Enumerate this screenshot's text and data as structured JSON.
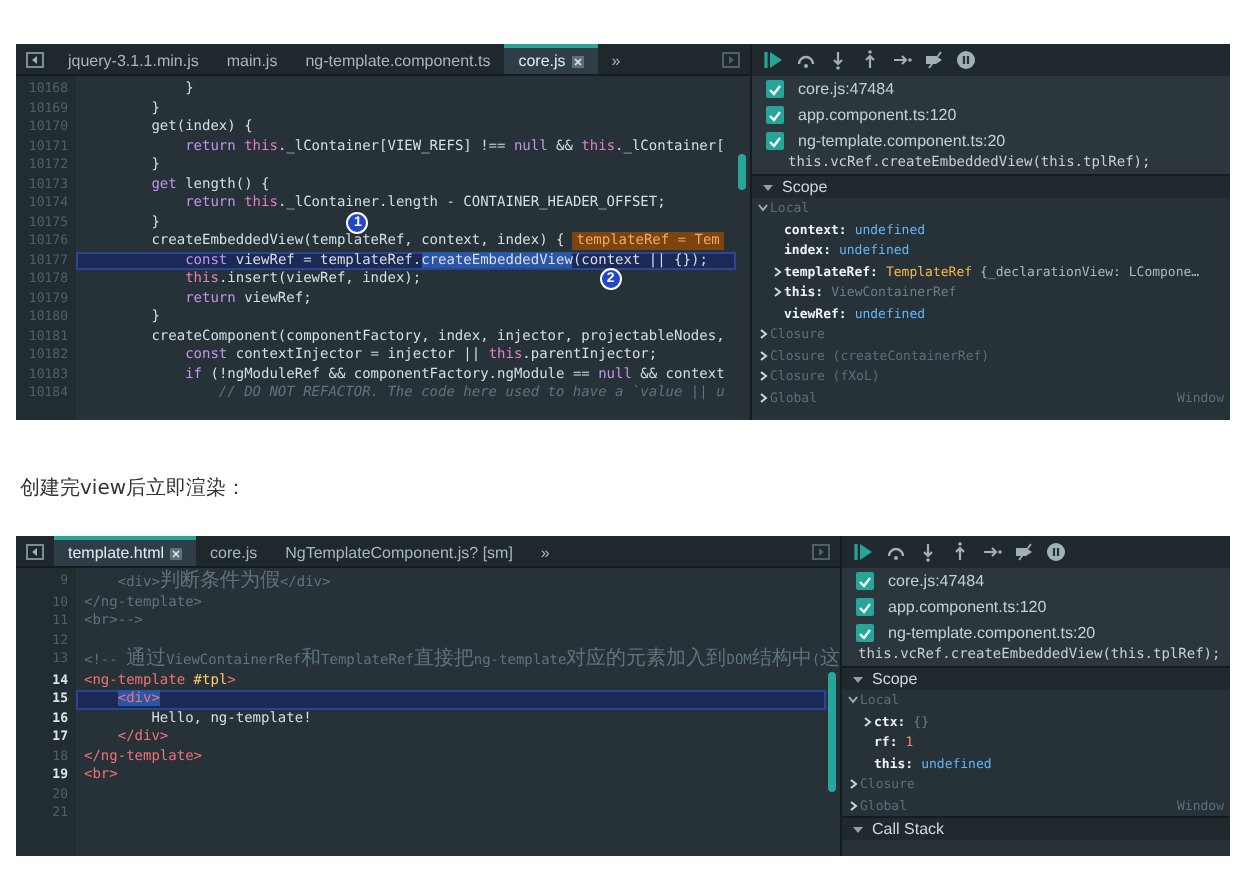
{
  "shots": [
    {
      "editor": {
        "tabs": [
          {
            "label": "jquery-3.1.1.min.js",
            "selected": false
          },
          {
            "label": "main.js",
            "selected": false
          },
          {
            "label": "ng-template.component.ts",
            "selected": false
          },
          {
            "label": "core.js",
            "selected": true
          }
        ],
        "overflow_label": "»",
        "lines": [
          {
            "number": "10168",
            "emphasized": false,
            "highlighted": false,
            "segments": [
              {
                "text": "            }",
                "kind": "plain"
              }
            ]
          },
          {
            "number": "10169",
            "emphasized": false,
            "highlighted": false,
            "segments": [
              {
                "text": "        }",
                "kind": "plain"
              }
            ]
          },
          {
            "number": "10170",
            "emphasized": false,
            "highlighted": false,
            "segments": [
              {
                "text": "        get(index) {",
                "kind": "plain"
              }
            ]
          },
          {
            "number": "10171",
            "emphasized": false,
            "highlighted": false,
            "segments": [
              {
                "text": "            return",
                "kind": "keyword"
              },
              {
                "text": " this",
                "kind": "this"
              },
              {
                "text": "._lContainer[VIEW_REFS] !== ",
                "kind": "plain"
              },
              {
                "text": "null",
                "kind": "keyword"
              },
              {
                "text": " && ",
                "kind": "plain"
              },
              {
                "text": "this",
                "kind": "this"
              },
              {
                "text": "._lContainer[",
                "kind": "plain"
              }
            ]
          },
          {
            "number": "10172",
            "emphasized": false,
            "highlighted": false,
            "segments": [
              {
                "text": "        }",
                "kind": "plain"
              }
            ]
          },
          {
            "number": "10173",
            "emphasized": false,
            "highlighted": false,
            "segments": [
              {
                "text": "        get",
                "kind": "keyword"
              },
              {
                "text": " length() {",
                "kind": "plain"
              }
            ]
          },
          {
            "number": "10174",
            "emphasized": false,
            "highlighted": false,
            "segments": [
              {
                "text": "            return",
                "kind": "keyword"
              },
              {
                "text": " this",
                "kind": "this"
              },
              {
                "text": "._lContainer.length - CONTAINER_HEADER_OFFSET;",
                "kind": "plain"
              }
            ]
          },
          {
            "number": "10175",
            "emphasized": false,
            "highlighted": false,
            "segments": [
              {
                "text": "        }",
                "kind": "plain"
              }
            ]
          },
          {
            "number": "10176",
            "emphasized": false,
            "highlighted": false,
            "hint": "templateRef = Tem",
            "segments": [
              {
                "text": "        createEmbeddedView(",
                "kind": "plain"
              },
              {
                "text": "templateRef",
                "kind": "plain",
                "marker": {
                  "label": "1",
                  "kind": "above"
                }
              },
              {
                "text": ", context, index) {",
                "kind": "plain"
              }
            ]
          },
          {
            "number": "10177",
            "emphasized": false,
            "highlighted": true,
            "segments": [
              {
                "text": "            const",
                "kind": "keyword"
              },
              {
                "text": " viewRef = templateRef.",
                "kind": "plain"
              },
              {
                "text": "createEmbeddedView",
                "kind": "plain",
                "selected": true
              },
              {
                "text": "(",
                "kind": "plain"
              },
              {
                "text": "context",
                "kind": "plain",
                "marker": {
                  "label": "2",
                  "kind": "below"
                }
              },
              {
                "text": " || {});",
                "kind": "plain"
              }
            ]
          },
          {
            "number": "10178",
            "emphasized": false,
            "highlighted": false,
            "segments": [
              {
                "text": "            this",
                "kind": "this"
              },
              {
                "text": ".insert(viewRef, index);",
                "kind": "plain"
              }
            ]
          },
          {
            "number": "10179",
            "emphasized": false,
            "highlighted": false,
            "segments": [
              {
                "text": "            return",
                "kind": "keyword"
              },
              {
                "text": " viewRef;",
                "kind": "plain"
              }
            ]
          },
          {
            "number": "10180",
            "emphasized": false,
            "highlighted": false,
            "segments": [
              {
                "text": "        }",
                "kind": "plain"
              }
            ]
          },
          {
            "number": "10181",
            "emphasized": false,
            "highlighted": false,
            "segments": [
              {
                "text": "        createComponent(componentFactory, index, injector, projectableNodes,",
                "kind": "plain"
              }
            ]
          },
          {
            "number": "10182",
            "emphasized": false,
            "highlighted": false,
            "segments": [
              {
                "text": "            const",
                "kind": "keyword"
              },
              {
                "text": " contextInjector = injector || ",
                "kind": "plain"
              },
              {
                "text": "this",
                "kind": "this"
              },
              {
                "text": ".parentInjector;",
                "kind": "plain"
              }
            ]
          },
          {
            "number": "10183",
            "emphasized": false,
            "highlighted": false,
            "segments": [
              {
                "text": "            if",
                "kind": "keyword"
              },
              {
                "text": " (!ngModuleRef && componentFactory.ngModule == ",
                "kind": "plain"
              },
              {
                "text": "null",
                "kind": "keyword"
              },
              {
                "text": " && context",
                "kind": "plain"
              }
            ]
          },
          {
            "number": "10184",
            "emphasized": false,
            "highlighted": false,
            "segments": [
              {
                "text": "                // DO NOT REFACTOR. The code here used to have a `value || u",
                "kind": "comment"
              }
            ]
          }
        ]
      },
      "debugger": {
        "breakpoints": [
          {
            "label": "core.js:47484",
            "checked": true
          },
          {
            "label": "app.component.ts:120",
            "checked": true
          },
          {
            "label": "ng-template.component.ts:20",
            "checked": true
          }
        ],
        "breakpoint_code": "this.vcRef.createEmbeddedView(this.tplRef);",
        "sections": [
          {
            "title": "Scope",
            "expanded": true,
            "groups": [
              {
                "label": "Local",
                "expanded": true,
                "children": [
                  {
                    "name": "context:",
                    "value": "undefined",
                    "kind": "undefined",
                    "expandable": false
                  },
                  {
                    "name": "index:",
                    "value": "undefined",
                    "kind": "undefined",
                    "expandable": false
                  },
                  {
                    "name": "templateRef:",
                    "value": "TemplateRef",
                    "kind": "object",
                    "preview": "{_declarationView: LCompone…",
                    "expandable": true
                  },
                  {
                    "name": "this:",
                    "value": "ViewContainerRef",
                    "kind": "dim",
                    "expandable": true
                  },
                  {
                    "name": "viewRef:",
                    "value": "undefined",
                    "kind": "undefined",
                    "expandable": false
                  }
                ]
              },
              {
                "label": "Closure",
                "expanded": false
              },
              {
                "label": "Closure (createContainerRef)",
                "expanded": false
              },
              {
                "label": "Closure (fXoL)",
                "expanded": false
              },
              {
                "label": "Global",
                "expanded": false,
                "value": "Window"
              }
            ]
          }
        ]
      }
    },
    {
      "editor": {
        "tabs": [
          {
            "label": "template.html",
            "selected": true
          },
          {
            "label": "core.js",
            "selected": false
          },
          {
            "label": "NgTemplateComponent.js? [sm]",
            "selected": false
          }
        ],
        "overflow_label": "»",
        "lines": [
          {
            "number": "9",
            "emphasized": false,
            "highlighted": false,
            "segments": [
              {
                "text": "    <div>判断条件为假</div>",
                "kind": "dim"
              }
            ]
          },
          {
            "number": "10",
            "emphasized": false,
            "highlighted": false,
            "segments": [
              {
                "text": "</ng-template>",
                "kind": "dim"
              }
            ]
          },
          {
            "number": "11",
            "emphasized": false,
            "highlighted": false,
            "segments": [
              {
                "text": "<br>-->",
                "kind": "dim"
              }
            ]
          },
          {
            "number": "12",
            "emphasized": false,
            "highlighted": false
          },
          {
            "number": "13",
            "emphasized": false,
            "highlighted": false,
            "segments": [
              {
                "text": "<!-- 通过ViewContainerRef和TemplateRef直接把ng-template对应的元素加入到DOM结构中(这",
                "kind": "dim"
              }
            ]
          },
          {
            "number": "14",
            "emphasized": true,
            "highlighted": false,
            "segments": [
              {
                "text": "<ng-template ",
                "kind": "tag"
              },
              {
                "text": "#tpl",
                "kind": "attr"
              },
              {
                "text": ">",
                "kind": "tag"
              }
            ]
          },
          {
            "number": "15",
            "emphasized": true,
            "highlighted": true,
            "segments": [
              {
                "text": "    <div>",
                "kind": "tag",
                "selected": true
              }
            ]
          },
          {
            "number": "16",
            "emphasized": true,
            "highlighted": false,
            "segments": [
              {
                "text": "        Hello, ng-template!",
                "kind": "plain"
              }
            ]
          },
          {
            "number": "17",
            "emphasized": true,
            "highlighted": false,
            "segments": [
              {
                "text": "    </div>",
                "kind": "tag"
              }
            ]
          },
          {
            "number": "18",
            "emphasized": false,
            "highlighted": false,
            "segments": [
              {
                "text": "</ng-template>",
                "kind": "tag"
              }
            ]
          },
          {
            "number": "19",
            "emphasized": true,
            "highlighted": false,
            "segments": [
              {
                "text": "<br>",
                "kind": "tag"
              }
            ]
          },
          {
            "number": "20",
            "emphasized": false,
            "highlighted": false
          },
          {
            "number": "21",
            "emphasized": false,
            "highlighted": false
          }
        ]
      },
      "debugger": {
        "breakpoints": [
          {
            "label": "core.js:47484",
            "checked": true
          },
          {
            "label": "app.component.ts:120",
            "checked": true
          },
          {
            "label": "ng-template.component.ts:20",
            "checked": true
          }
        ],
        "breakpoint_code": "this.vcRef.createEmbeddedView(this.tplRef);",
        "sections": [
          {
            "title": "Scope",
            "expanded": true,
            "groups": [
              {
                "label": "Local",
                "expanded": true,
                "children": [
                  {
                    "name": "ctx:",
                    "value": "{}",
                    "kind": "dim",
                    "expandable": true
                  },
                  {
                    "name": "rf:",
                    "value": "1",
                    "kind": "number",
                    "expandable": false
                  },
                  {
                    "name": "this:",
                    "value": "undefined",
                    "kind": "undefined",
                    "expandable": false
                  }
                ]
              },
              {
                "label": "Closure",
                "expanded": false
              },
              {
                "label": "Global",
                "expanded": false,
                "value": "Window"
              }
            ]
          },
          {
            "title": "Call Stack",
            "expanded": true
          }
        ]
      }
    }
  ],
  "caption": "创建完view后立即渲染："
}
